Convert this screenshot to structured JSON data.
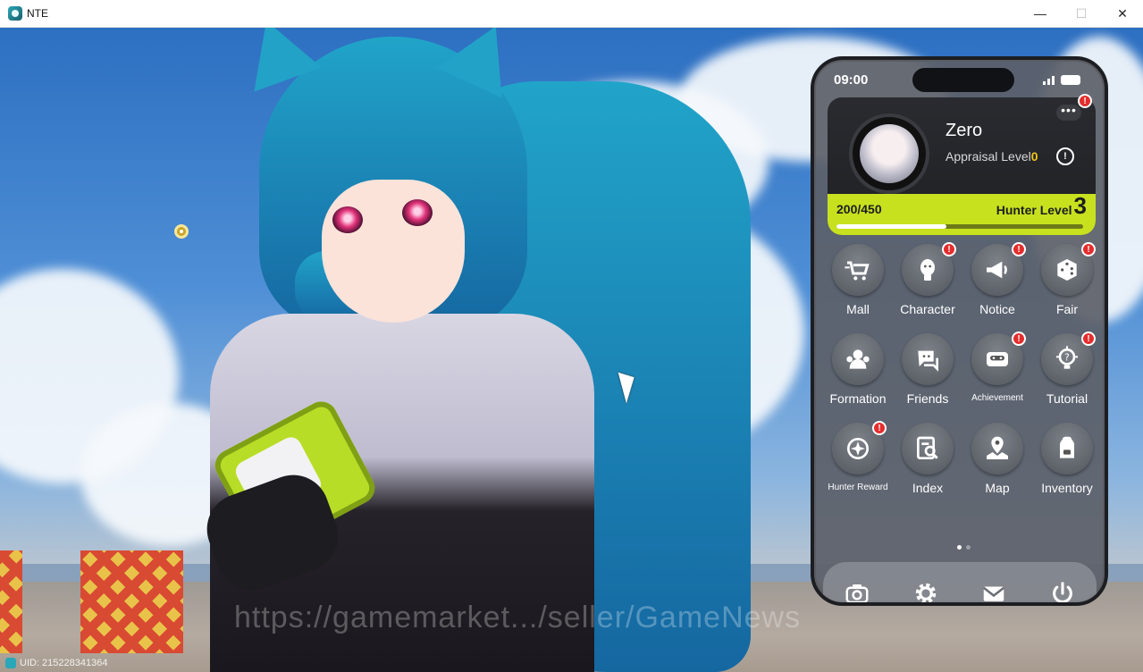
{
  "window": {
    "title": "NTE",
    "min_glyph": "—",
    "max_glyph": "☐",
    "close_glyph": "✕"
  },
  "scene": {
    "watermark": "https://gamemarket.../seller/GameNews",
    "uid": "UID: 215228341364"
  },
  "phone": {
    "status_time": "09:00",
    "profile": {
      "name": "Zero",
      "appraisal_label": "Appraisal Level",
      "appraisal_value": "0",
      "exp_text": "200/450",
      "exp_fraction": 0.444,
      "hunter_level_label": "Hunter Level",
      "hunter_level_value": "3",
      "more_glyph": "•••",
      "info_glyph": "!"
    },
    "apps": [
      {
        "label": "Mall",
        "icon": "cart-icon",
        "badge": false
      },
      {
        "label": "Character",
        "icon": "character-icon",
        "badge": true
      },
      {
        "label": "Notice",
        "icon": "megaphone-icon",
        "badge": true
      },
      {
        "label": "Fair",
        "icon": "dice-icon",
        "badge": true
      },
      {
        "label": "Formation",
        "icon": "formation-icon",
        "badge": false
      },
      {
        "label": "Friends",
        "icon": "friends-icon",
        "badge": false
      },
      {
        "label": "Achievement",
        "icon": "achievement-icon",
        "badge": true
      },
      {
        "label": "Tutorial",
        "icon": "bulb-icon",
        "badge": true
      },
      {
        "label": "Hunter Reward",
        "icon": "target-icon",
        "badge": true
      },
      {
        "label": "Index",
        "icon": "index-icon",
        "badge": false
      },
      {
        "label": "Map",
        "icon": "map-pin-icon",
        "badge": false
      },
      {
        "label": "Inventory",
        "icon": "backpack-icon",
        "badge": false
      }
    ],
    "badge_glyph": "!",
    "page_dots": {
      "count": 2,
      "active": 0
    },
    "dock": [
      "camera-icon",
      "settings-icon",
      "mail-icon",
      "power-icon"
    ],
    "colors": {
      "accent": "#c8e11f",
      "badge": "#e52c2c",
      "appraisal": "#f0c419"
    }
  }
}
